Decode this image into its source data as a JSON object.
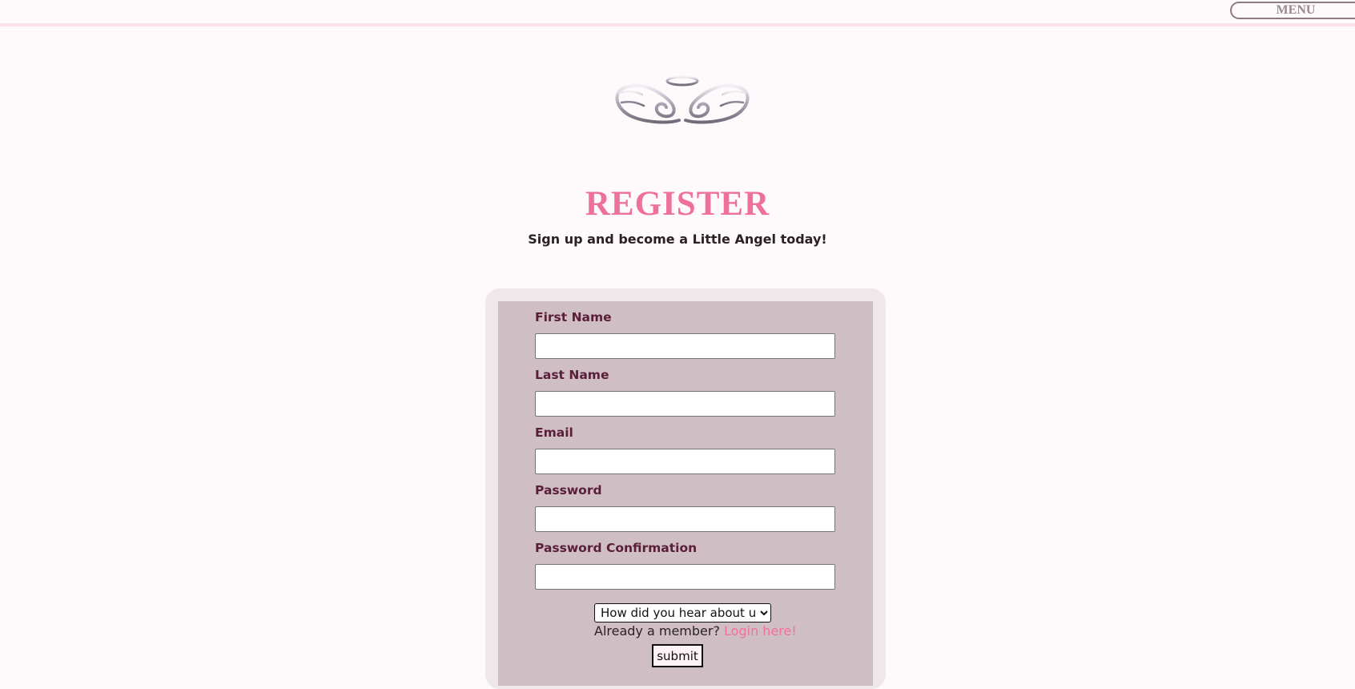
{
  "header": {
    "menu_label": "MENU"
  },
  "logo": {
    "icon": "angel-wings-halo-icon"
  },
  "page": {
    "title": "REGISTER",
    "subtitle": "Sign up and become a Little Angel today!"
  },
  "form": {
    "fields": [
      {
        "label": "First Name",
        "value": ""
      },
      {
        "label": "Last Name",
        "value": ""
      },
      {
        "label": "Email",
        "value": ""
      },
      {
        "label": "Password",
        "value": ""
      },
      {
        "label": "Password Confirmation",
        "value": ""
      }
    ],
    "referral_select": {
      "selected": "How did you hear about us?"
    },
    "member_prompt": "Already a member?",
    "login_link": "Login here!",
    "submit_label": "submit"
  },
  "colors": {
    "background": "#fef9fa",
    "accent": "#ee719d",
    "card": "#cfbfc5",
    "label": "#5a1e36"
  }
}
